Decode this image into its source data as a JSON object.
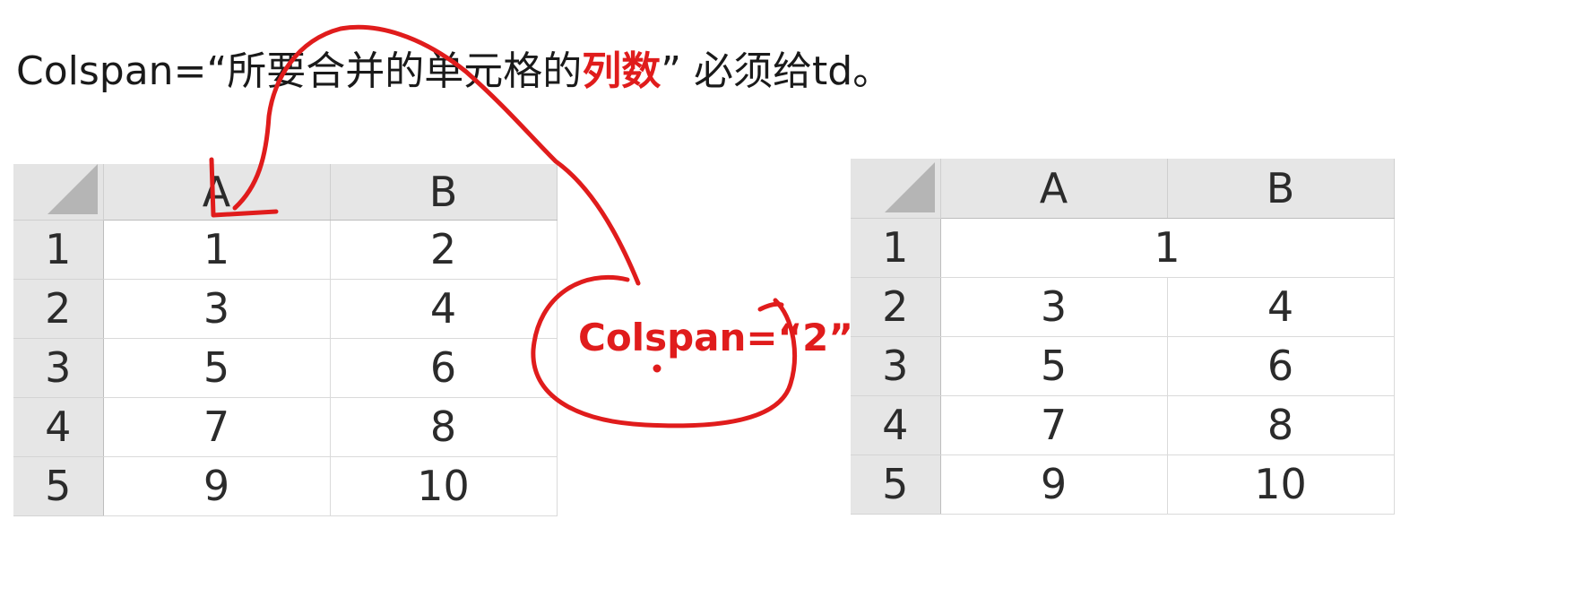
{
  "heading": {
    "prefix": "Colspan=“所要合并的单元格的",
    "highlight": "列数",
    "suffix": "” 必须给td。"
  },
  "table_left": {
    "columns": [
      "A",
      "B"
    ],
    "rows": [
      {
        "num": "1",
        "a": "1",
        "b": "2"
      },
      {
        "num": "2",
        "a": "3",
        "b": "4"
      },
      {
        "num": "3",
        "a": "5",
        "b": "6"
      },
      {
        "num": "4",
        "a": "7",
        "b": "8"
      },
      {
        "num": "5",
        "a": "9",
        "b": "10"
      }
    ]
  },
  "annotation": {
    "label": "Colspan=“2”",
    "ink_color": "#e01c1c"
  },
  "table_right": {
    "columns": [
      "A",
      "B"
    ],
    "merged_row": {
      "num": "1",
      "value": "1"
    },
    "rows": [
      {
        "num": "2",
        "a": "3",
        "b": "4"
      },
      {
        "num": "3",
        "a": "5",
        "b": "6"
      },
      {
        "num": "4",
        "a": "7",
        "b": "8"
      },
      {
        "num": "5",
        "a": "9",
        "b": "10"
      }
    ]
  }
}
